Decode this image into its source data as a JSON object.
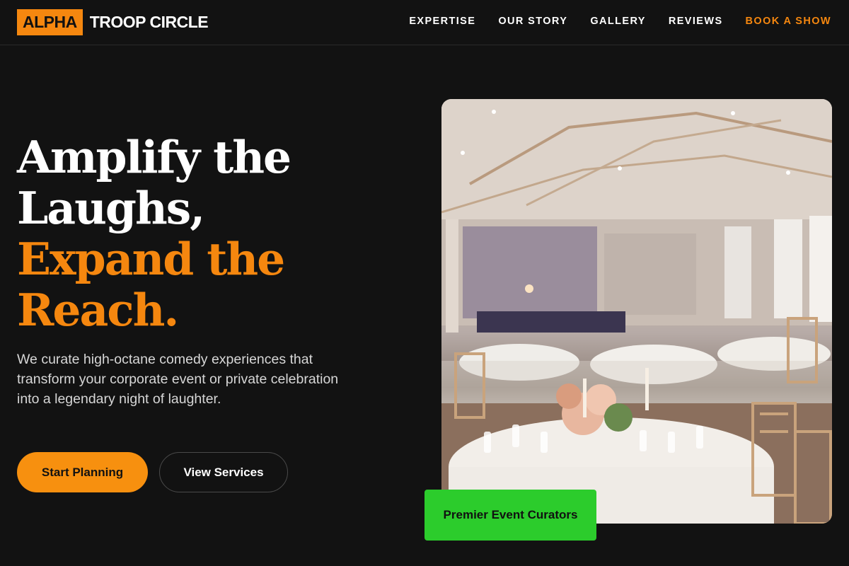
{
  "brand": {
    "badge": "ALPHA",
    "name": "TROOP CIRCLE"
  },
  "nav": {
    "links": [
      "EXPERTISE",
      "OUR STORY",
      "GALLERY",
      "REVIEWS"
    ],
    "cta": "BOOK A SHOW"
  },
  "hero": {
    "headline_white": [
      "Amplify the",
      "Laughs,"
    ],
    "headline_orange": [
      "Expand the",
      "Reach."
    ],
    "description": "We curate high-octane comedy experiences that transform your corporate event or private celebration into a legendary night of laughter.",
    "primary_button": "Start Planning",
    "secondary_button": "View Services",
    "image_alt": "Banquet hall with round tables and chiavari chairs",
    "badge": "Premier Event Curators"
  },
  "colors": {
    "accent": "#f5870f",
    "background": "#121212",
    "badge": "#2ccc2c"
  }
}
